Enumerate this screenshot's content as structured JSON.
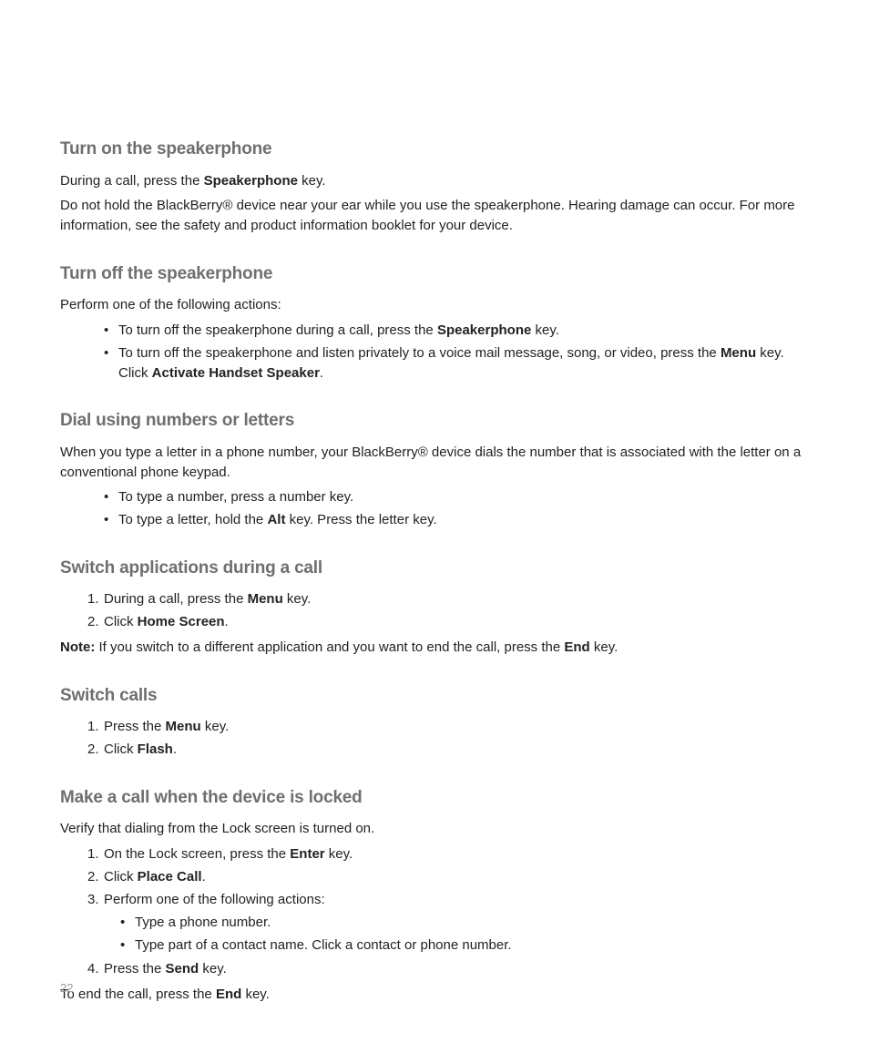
{
  "pageNumber": "22",
  "sections": {
    "s1": {
      "heading": "Turn on the speakerphone",
      "p1a": "During a call, press the ",
      "p1b": "Speakerphone",
      "p1c": " key.",
      "p2": "Do not hold the BlackBerry® device near your ear while you use the speakerphone. Hearing damage can occur. For more information, see the safety and product information booklet for your device."
    },
    "s2": {
      "heading": "Turn off the speakerphone",
      "intro": "Perform one of the following actions:",
      "b1a": "To turn off the speakerphone during a call, press the ",
      "b1b": "Speakerphone",
      "b1c": " key.",
      "b2a": "To turn off the speakerphone and listen privately to a voice mail message, song, or video, press the ",
      "b2b": "Menu",
      "b2c": " key. Click ",
      "b2d": "Activate Handset Speaker",
      "b2e": "."
    },
    "s3": {
      "heading": "Dial using numbers or letters",
      "intro": "When you type a letter in a phone number, your BlackBerry® device dials the number that is associated with the letter on a conventional phone keypad.",
      "b1": "To type a number, press a number key.",
      "b2a": "To type a letter, hold the ",
      "b2b": "Alt",
      "b2c": " key. Press the letter key."
    },
    "s4": {
      "heading": "Switch applications during a call",
      "o1a": "During a call, press the ",
      "o1b": "Menu",
      "o1c": " key.",
      "o2a": "Click ",
      "o2b": "Home Screen",
      "o2c": ".",
      "noteLabel": "Note:",
      "noteA": " If you switch to a different application and you want to end the call, press the ",
      "noteB": "End",
      "noteC": " key."
    },
    "s5": {
      "heading": "Switch calls",
      "o1a": "Press the ",
      "o1b": "Menu",
      "o1c": " key.",
      "o2a": "Click ",
      "o2b": "Flash",
      "o2c": "."
    },
    "s6": {
      "heading": "Make a call when the device is locked",
      "intro": "Verify that dialing from the Lock screen is turned on.",
      "o1a": "On the Lock screen, press the ",
      "o1b": "Enter",
      "o1c": " key.",
      "o2a": "Click ",
      "o2b": "Place Call",
      "o2c": ".",
      "o3": "Perform one of the following actions:",
      "o3b1": "Type a phone number.",
      "o3b2": "Type part of a contact name. Click a contact or phone number.",
      "o4a": "Press the ",
      "o4b": "Send",
      "o4c": " key.",
      "outroA": "To end the call, press the ",
      "outroB": "End",
      "outroC": " key."
    }
  }
}
